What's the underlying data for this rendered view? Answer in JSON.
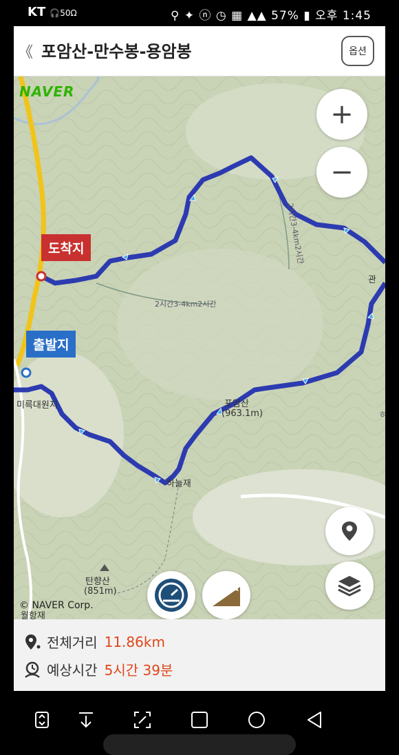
{
  "status_bar": {
    "carrier": "KT",
    "headphone": "50Ω",
    "battery": "57%",
    "time": "오후 1:45"
  },
  "header": {
    "back_icon": "chevron-left-icon",
    "title": "포암산-만수봉-용암봉",
    "option_label": "옵션"
  },
  "map": {
    "brand": "NAVER",
    "copyright": "© NAVER Corp.",
    "zoom_in_label": "+",
    "zoom_out_label": "−",
    "markers": {
      "end": "도착지",
      "start": "출발지"
    },
    "labels": {
      "miruk": "미륵대원지",
      "poamsan": "포암산",
      "poamsan_elev": "(963.1m)",
      "haneuljae": "하늘재",
      "tanhyangsan": "탄향산",
      "tanhyangsan_elev": "(851m)",
      "wolhyangjae": "월항재",
      "trail_a": "2시간3-4km2시간",
      "trail_b": "2시간3-4km2시간",
      "gwan": "관",
      "edge_char": "ㅎ"
    },
    "route_color": "#2c3bb0",
    "buttons": [
      "location-pin-icon",
      "layers-icon",
      "speedometer-icon",
      "elevation-icon"
    ]
  },
  "info": {
    "distance_label": "전체거리",
    "distance_value": "11.86km",
    "time_label": "예상시간",
    "time_value": "5시간 39분"
  },
  "nav_bar": [
    "screen-rotate-icon",
    "download-icon",
    "screenshot-icon",
    "recents-icon",
    "home-icon",
    "back-icon"
  ]
}
